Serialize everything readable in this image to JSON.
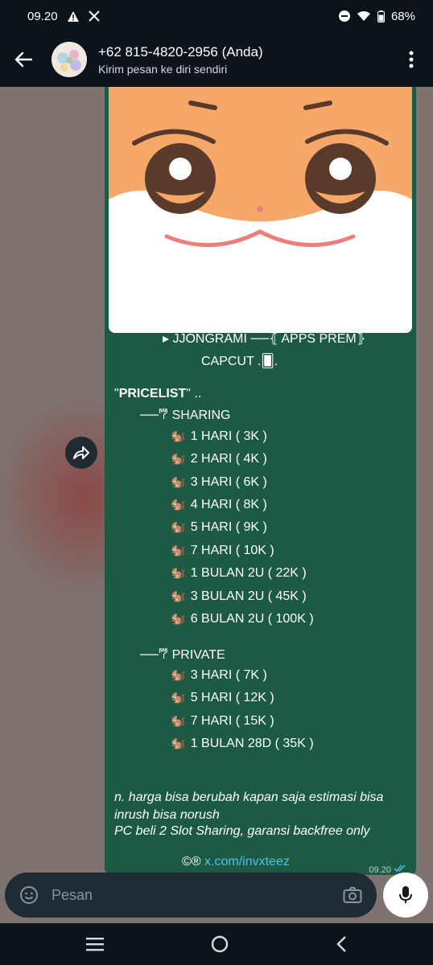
{
  "status_bar": {
    "time": "09.20",
    "battery": "68%",
    "icons": [
      "warning-icon",
      "x-logo-icon",
      "dnd-icon",
      "wifi-icon",
      "battery-icon"
    ]
  },
  "header": {
    "title": "+62 815-4820-2956 (Anda)",
    "subtitle": "Kirim pesan ke diri sendiri"
  },
  "message": {
    "line1": "▸ JJONGRAMI ──⦃ APPS PREM⦄",
    "line2": "CAPCUT .🂠.",
    "pricelist_quote_open": "\"",
    "pricelist_bold": "PRICELIST",
    "pricelist_quote_close": "\"  ..",
    "sharing_header": "──𐂐 SHARING",
    "sharing_items": [
      "1 HARI ( 3K )",
      "2 HARI ( 4K )",
      "3 HARI ( 6K )",
      "4 HARI ( 8K )",
      "5 HARI ( 9K )",
      "7 HARI ( 10K )",
      "1 BULAN 2U ( 22K )",
      "3 BULAN 2U ( 45K )",
      "6 BULAN 2U ( 100K )"
    ],
    "private_header": "──𐂐 PRIVATE",
    "private_items": [
      "3 HARI ( 7K )",
      "5 HARI ( 12K )",
      "7 HARI  ( 15K )",
      "1 BULAN 28D  ( 35K )"
    ],
    "bullet_emoji": "🐿️",
    "note1": "n. harga bisa berubah kapan saja estimasi bisa inrush bisa norush",
    "note2": "PC beli 2 Slot Sharing, garansi backfree only",
    "footer_prefix": "©®",
    "footer_link": "x.com/invxteez",
    "time": "09.20"
  },
  "composer": {
    "placeholder": "Pesan"
  },
  "colors": {
    "bubble": "#1d5a44",
    "chat_bg": "#7f7370",
    "bar_bg": "#0b141a",
    "link": "#53bdeb"
  }
}
